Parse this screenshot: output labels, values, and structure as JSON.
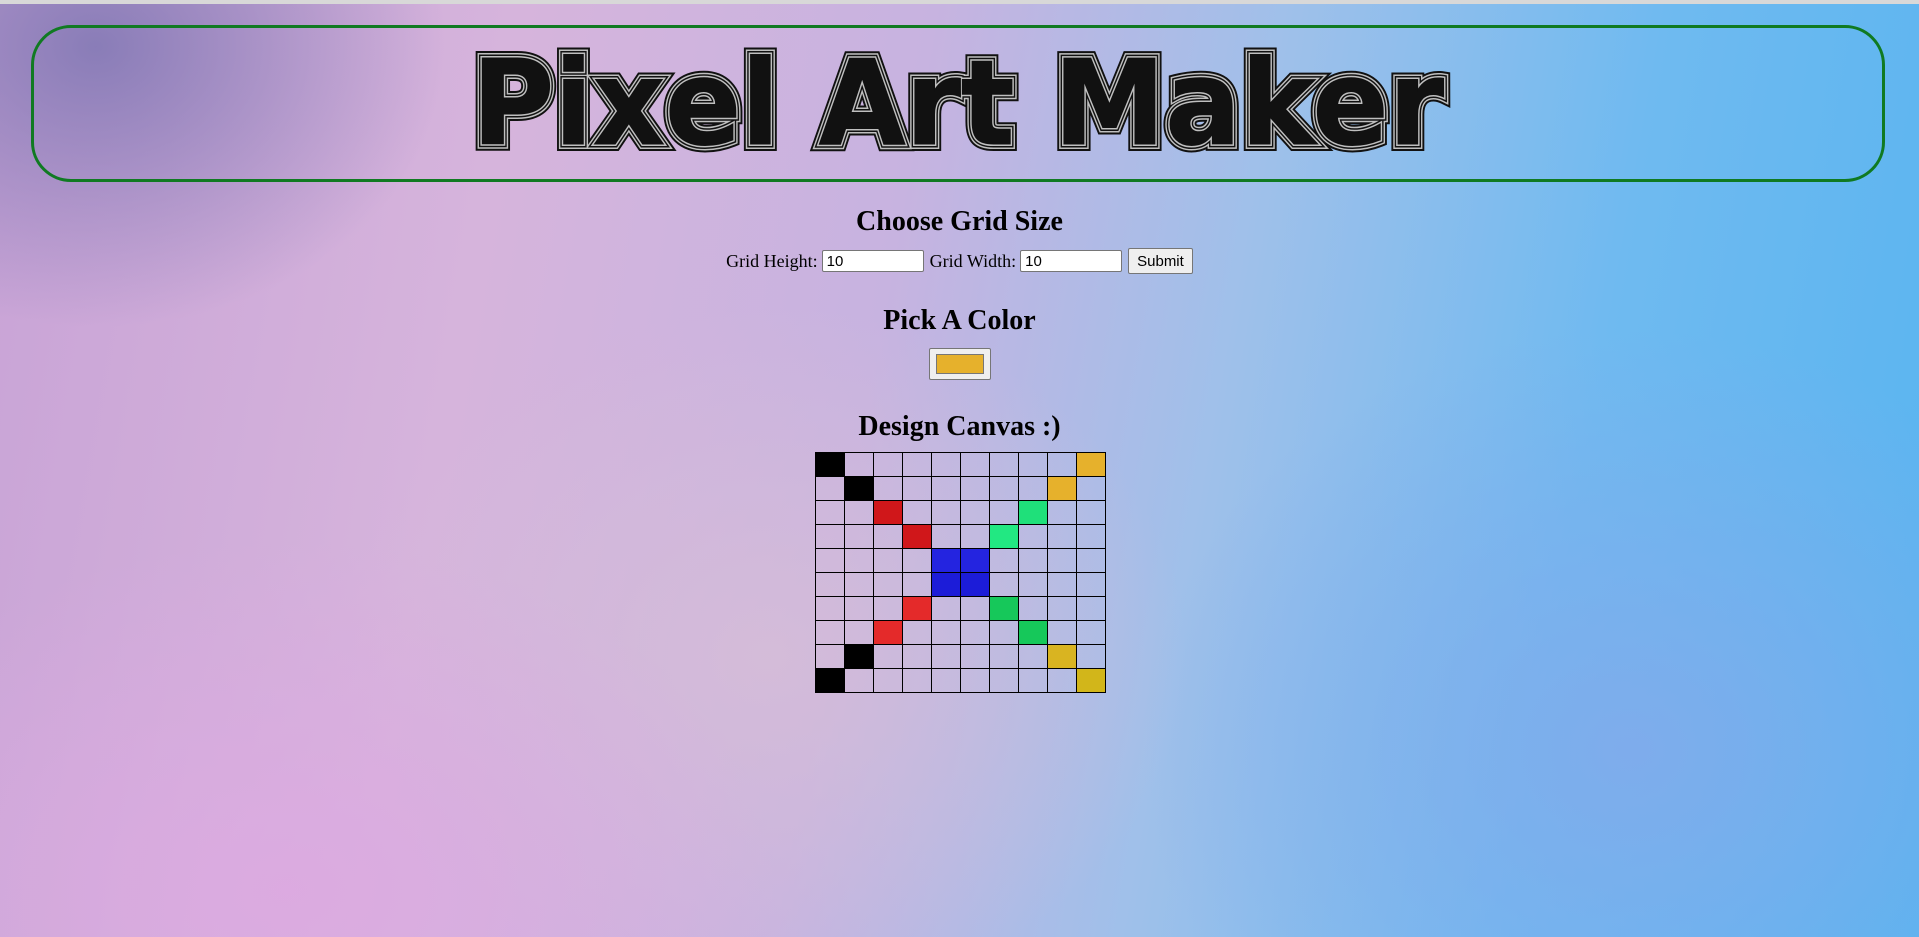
{
  "header": {
    "title": "Pixel Art Maker"
  },
  "grid_size": {
    "heading": "Choose Grid Size",
    "height_label": "Grid Height:",
    "height_value": "10",
    "width_label": "Grid Width:",
    "width_value": "10",
    "submit_label": "Submit"
  },
  "color_section": {
    "heading": "Pick A Color",
    "selected_color": "#e6b12c"
  },
  "canvas_section": {
    "heading": "Design Canvas :)",
    "rows": 10,
    "cols": 10,
    "painted_cells": [
      {
        "row": 0,
        "col": 0,
        "color": "#000000"
      },
      {
        "row": 0,
        "col": 9,
        "color": "#e6b12c"
      },
      {
        "row": 1,
        "col": 1,
        "color": "#000000"
      },
      {
        "row": 1,
        "col": 8,
        "color": "#e6b12c"
      },
      {
        "row": 2,
        "col": 2,
        "color": "#d0171a"
      },
      {
        "row": 2,
        "col": 7,
        "color": "#1fe07a"
      },
      {
        "row": 3,
        "col": 3,
        "color": "#d0171a"
      },
      {
        "row": 3,
        "col": 6,
        "color": "#22e882"
      },
      {
        "row": 4,
        "col": 4,
        "color": "#2424e0"
      },
      {
        "row": 4,
        "col": 5,
        "color": "#2424e0"
      },
      {
        "row": 5,
        "col": 4,
        "color": "#1c1cd8"
      },
      {
        "row": 5,
        "col": 5,
        "color": "#1c1cd8"
      },
      {
        "row": 6,
        "col": 3,
        "color": "#e42a2a"
      },
      {
        "row": 6,
        "col": 6,
        "color": "#16c85a"
      },
      {
        "row": 7,
        "col": 2,
        "color": "#e42a2a"
      },
      {
        "row": 7,
        "col": 7,
        "color": "#16c85a"
      },
      {
        "row": 8,
        "col": 1,
        "color": "#000000"
      },
      {
        "row": 8,
        "col": 8,
        "color": "#d9b421"
      },
      {
        "row": 9,
        "col": 0,
        "color": "#000000"
      },
      {
        "row": 9,
        "col": 9,
        "color": "#d2b61a"
      }
    ]
  }
}
